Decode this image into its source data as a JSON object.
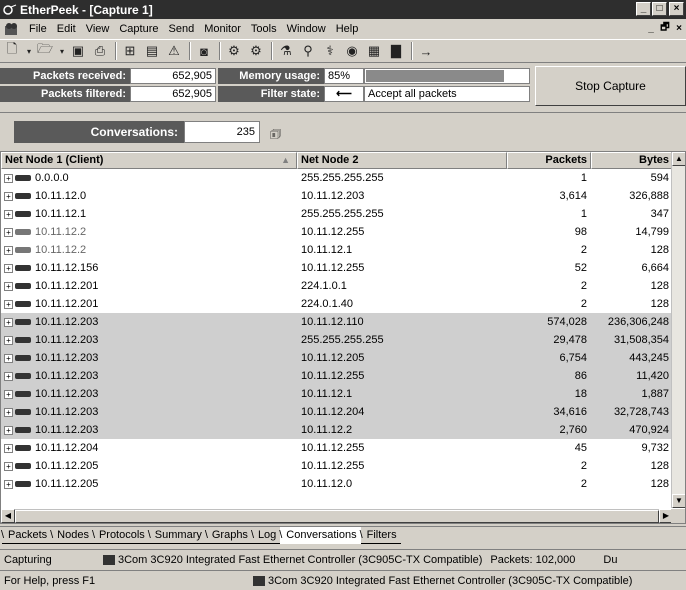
{
  "window": {
    "title": "EtherPeek - [Capture 1]"
  },
  "menu": {
    "items": [
      "File",
      "Edit",
      "View",
      "Capture",
      "Send",
      "Monitor",
      "Tools",
      "Window",
      "Help"
    ]
  },
  "stats": {
    "packets_received_label": "Packets received:",
    "packets_received": "652,905",
    "packets_filtered_label": "Packets filtered:",
    "packets_filtered": "652,905",
    "memory_label": "Memory usage:",
    "memory_value": "85%",
    "memory_fraction": 0.85,
    "filter_label": "Filter state:",
    "filter_value": "Accept all packets",
    "stop_button": "Stop Capture"
  },
  "conversations": {
    "label": "Conversations:",
    "count": "235"
  },
  "table": {
    "headers": [
      "Net Node 1 (Client)",
      "Net Node 2",
      "Packets",
      "Bytes"
    ],
    "rows": [
      {
        "n1": "0.0.0.0",
        "n2": "255.255.255.255",
        "packets": "1",
        "bytes": "594",
        "hl": false,
        "grey": false
      },
      {
        "n1": "10.11.12.0",
        "n2": "10.11.12.203",
        "packets": "3,614",
        "bytes": "326,888",
        "hl": false,
        "grey": false
      },
      {
        "n1": "10.11.12.1",
        "n2": "255.255.255.255",
        "packets": "1",
        "bytes": "347",
        "hl": false,
        "grey": false
      },
      {
        "n1": "10.11.12.2",
        "n2": "10.11.12.255",
        "packets": "98",
        "bytes": "14,799",
        "hl": false,
        "grey": true
      },
      {
        "n1": "10.11.12.2",
        "n2": "10.11.12.1",
        "packets": "2",
        "bytes": "128",
        "hl": false,
        "grey": true
      },
      {
        "n1": "10.11.12.156",
        "n2": "10.11.12.255",
        "packets": "52",
        "bytes": "6,664",
        "hl": false,
        "grey": false
      },
      {
        "n1": "10.11.12.201",
        "n2": "224.1.0.1",
        "packets": "2",
        "bytes": "128",
        "hl": false,
        "grey": false
      },
      {
        "n1": "10.11.12.201",
        "n2": "224.0.1.40",
        "packets": "2",
        "bytes": "128",
        "hl": false,
        "grey": false
      },
      {
        "n1": "10.11.12.203",
        "n2": "10.11.12.110",
        "packets": "574,028",
        "bytes": "236,306,248",
        "hl": true,
        "grey": false
      },
      {
        "n1": "10.11.12.203",
        "n2": "255.255.255.255",
        "packets": "29,478",
        "bytes": "31,508,354",
        "hl": true,
        "grey": false
      },
      {
        "n1": "10.11.12.203",
        "n2": "10.11.12.205",
        "packets": "6,754",
        "bytes": "443,245",
        "hl": true,
        "grey": false
      },
      {
        "n1": "10.11.12.203",
        "n2": "10.11.12.255",
        "packets": "86",
        "bytes": "11,420",
        "hl": true,
        "grey": false
      },
      {
        "n1": "10.11.12.203",
        "n2": "10.11.12.1",
        "packets": "18",
        "bytes": "1,887",
        "hl": true,
        "grey": false
      },
      {
        "n1": "10.11.12.203",
        "n2": "10.11.12.204",
        "packets": "34,616",
        "bytes": "32,728,743",
        "hl": true,
        "grey": false
      },
      {
        "n1": "10.11.12.203",
        "n2": "10.11.12.2",
        "packets": "2,760",
        "bytes": "470,924",
        "hl": true,
        "grey": false
      },
      {
        "n1": "10.11.12.204",
        "n2": "10.11.12.255",
        "packets": "45",
        "bytes": "9,732",
        "hl": false,
        "grey": false
      },
      {
        "n1": "10.11.12.205",
        "n2": "10.11.12.255",
        "packets": "2",
        "bytes": "128",
        "hl": false,
        "grey": false
      },
      {
        "n1": "10.11.12.205",
        "n2": "10.11.12.0",
        "packets": "2",
        "bytes": "128",
        "hl": false,
        "grey": false
      }
    ]
  },
  "tabs": [
    "Packets",
    "Nodes",
    "Protocols",
    "Summary",
    "Graphs",
    "Log",
    "Conversations",
    "Filters"
  ],
  "active_tab": "Conversations",
  "status": {
    "state": "Capturing",
    "adapter": "3Com 3C920 Integrated Fast Ethernet Controller (3C905C-TX Compatible)",
    "packets": "Packets: 102,000",
    "extra": "Du",
    "help": "For Help, press F1",
    "adapter2": "3Com 3C920 Integrated Fast Ethernet Controller (3C905C-TX Compatible)"
  },
  "icons": [
    "app-icon",
    "new-icon",
    "open-icon",
    "save-icon",
    "print-icon",
    "stop-icon"
  ]
}
